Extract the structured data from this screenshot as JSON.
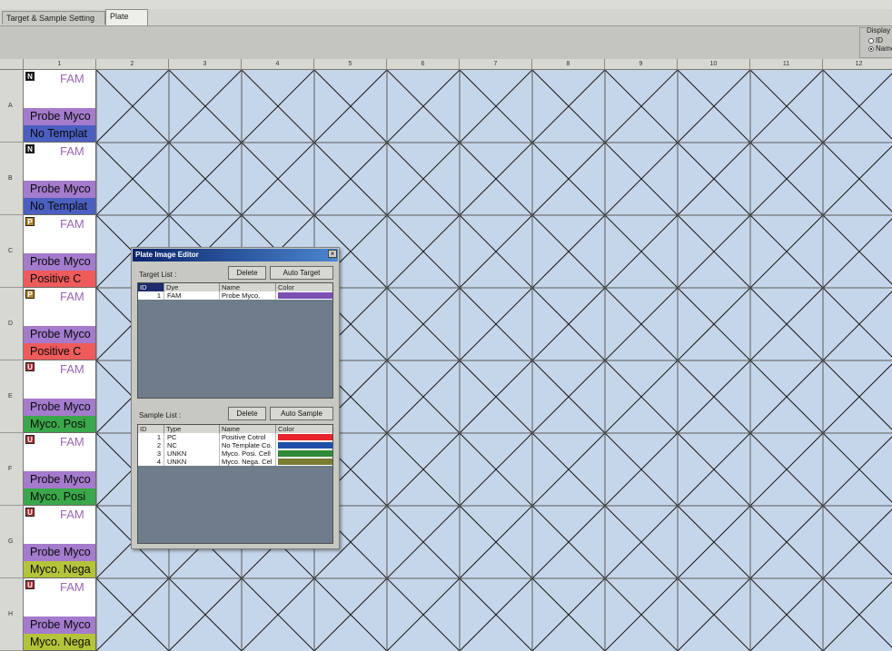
{
  "tabs": [
    {
      "label": "Target & Sample Setting",
      "active": false
    },
    {
      "label": "Plate Image",
      "active": true
    }
  ],
  "display": {
    "legend": "Display",
    "options": [
      {
        "label": "ID",
        "selected": false
      },
      {
        "label": "Name",
        "selected": true
      }
    ]
  },
  "columns": [
    "1",
    "2",
    "3",
    "4",
    "5",
    "6",
    "7",
    "8",
    "9",
    "10",
    "11",
    "12"
  ],
  "rows": [
    {
      "label": "A",
      "badge": "N",
      "badge_color": "#111111",
      "dye": "FAM",
      "target": "Probe Myco",
      "sample": "No Templat",
      "sample_color": "#4a5fbf"
    },
    {
      "label": "B",
      "badge": "N",
      "badge_color": "#111111",
      "dye": "FAM",
      "target": "Probe Myco",
      "sample": "No Templat",
      "sample_color": "#4a5fbf"
    },
    {
      "label": "C",
      "badge": "P",
      "badge_color": "#b8862a",
      "dye": "FAM",
      "target": "Probe Myco",
      "sample": "Positive C",
      "sample_color": "#ef5b5b"
    },
    {
      "label": "D",
      "badge": "P",
      "badge_color": "#b8862a",
      "dye": "FAM",
      "target": "Probe Myco",
      "sample": "Positive C",
      "sample_color": "#ef5b5b"
    },
    {
      "label": "E",
      "badge": "U",
      "badge_color": "#b03030",
      "dye": "FAM",
      "target": "Probe Myco",
      "sample": "Myco. Posi",
      "sample_color": "#3aa84a"
    },
    {
      "label": "F",
      "badge": "U",
      "badge_color": "#b03030",
      "dye": "FAM",
      "target": "Probe Myco",
      "sample": "Myco. Posi",
      "sample_color": "#3aa84a"
    },
    {
      "label": "G",
      "badge": "U",
      "badge_color": "#b03030",
      "dye": "FAM",
      "target": "Probe Myco",
      "sample": "Myco. Nega",
      "sample_color": "#b4c43a"
    },
    {
      "label": "H",
      "badge": "U",
      "badge_color": "#b03030",
      "dye": "FAM",
      "target": "Probe Myco",
      "sample": "Myco. Nega",
      "sample_color": "#b4c43a"
    }
  ],
  "editor": {
    "title": "Plate Image Editor",
    "close": "×",
    "target": {
      "label": "Target List :",
      "delete": "Delete",
      "auto": "Auto Target",
      "headers": [
        "ID",
        "Dye",
        "Name",
        "Color"
      ],
      "rows": [
        {
          "id": "1",
          "dye": "FAM",
          "name": "Probe Myco.",
          "color": "#7b4fb3"
        }
      ]
    },
    "sample": {
      "label": "Sample List :",
      "delete": "Delete",
      "auto": "Auto Sample",
      "headers": [
        "ID",
        "Type",
        "Name",
        "Color"
      ],
      "rows": [
        {
          "id": "1",
          "type": "PC",
          "name": "Positive Cotrol",
          "color": "#e8232a"
        },
        {
          "id": "2",
          "type": "NC",
          "name": "No Template Co.",
          "color": "#1f4fa8"
        },
        {
          "id": "3",
          "type": "UNKN",
          "name": "Myco. Posi. Cell",
          "color": "#2f8a3a"
        },
        {
          "id": "4",
          "type": "UNKN",
          "name": "Myco. Nega. Cel",
          "color": "#7b7b34"
        }
      ]
    }
  }
}
